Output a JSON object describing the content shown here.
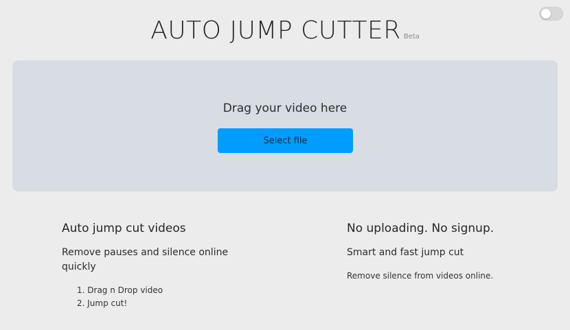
{
  "header": {
    "title": "AUTO JUMP CUTTER",
    "badge": "Beta"
  },
  "theme_toggle": {
    "state": "off"
  },
  "dropzone": {
    "prompt": "Drag your video here",
    "button_label": "Select file"
  },
  "features": {
    "left": {
      "heading": "Auto jump cut videos",
      "description": "Remove pauses and silence online quickly",
      "steps": [
        "1. Drag n Drop video",
        "2. Jump cut!"
      ]
    },
    "right": {
      "heading": "No uploading. No signup.",
      "subheading": "Smart and fast jump cut",
      "description": "Remove silence from videos online."
    }
  },
  "colors": {
    "background": "#ececec",
    "dropzone": "#d8dce3",
    "button": "#009dff"
  }
}
